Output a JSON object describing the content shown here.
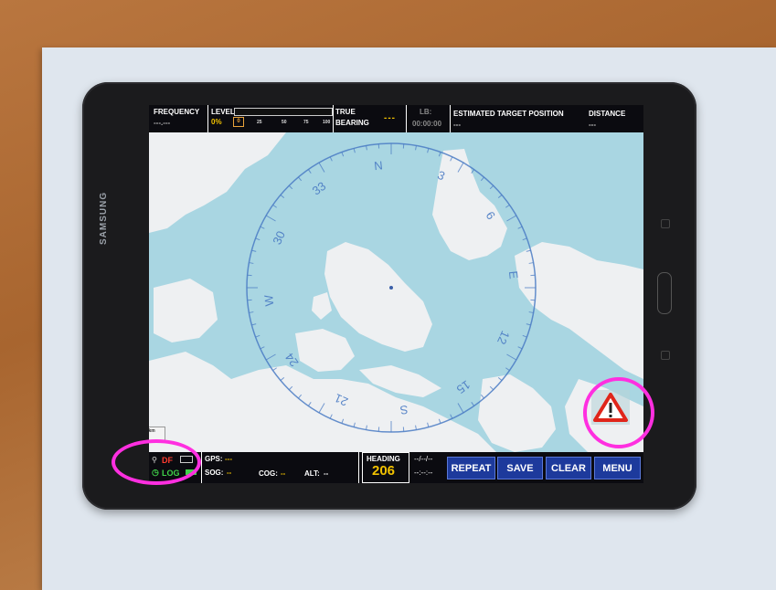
{
  "device": {
    "brand": "SAMSUNG"
  },
  "topbar": {
    "frequency_label": "FREQUENCY",
    "frequency_value": "---.---",
    "level_label": "LEVEL",
    "level_value": "0%",
    "level_scale": [
      "0",
      "25",
      "50",
      "75",
      "100"
    ],
    "true_label": "TRUE",
    "bearing_label": "BEARING",
    "bearing_value": "---",
    "lb_label": "LB:",
    "lb_value": "00:00:00",
    "estimated_label": "ESTIMATED TARGET POSITION",
    "estimated_value": "---",
    "distance_label": "DISTANCE",
    "distance_value": "---"
  },
  "compass": {
    "labels": [
      "S",
      "21",
      "24",
      "W",
      "30",
      "33",
      "N",
      "3",
      "6",
      "E",
      "12",
      "15"
    ]
  },
  "map": {
    "scale_tag": "2000 km"
  },
  "bottombar": {
    "df_label": "DF",
    "log_label": "LOG",
    "gps_label": "GPS:",
    "gps_value": "---",
    "sog_label": "SOG:",
    "sog_value": "--",
    "cog_label": "COG:",
    "cog_value": "--",
    "alt_label": "ALT:",
    "alt_value": "--",
    "heading_label": "HEADING",
    "heading_value": "206",
    "date_value": "--/--/--",
    "time_value": "--:--:--",
    "buttons": {
      "repeat": "REPEAT",
      "save": "SAVE",
      "clear": "CLEAR",
      "menu": "MENU"
    }
  },
  "colors": {
    "accent": "#f2c200",
    "button": "#1d3a9c",
    "highlight": "#ff2fe0",
    "alert": "#e0261b"
  }
}
